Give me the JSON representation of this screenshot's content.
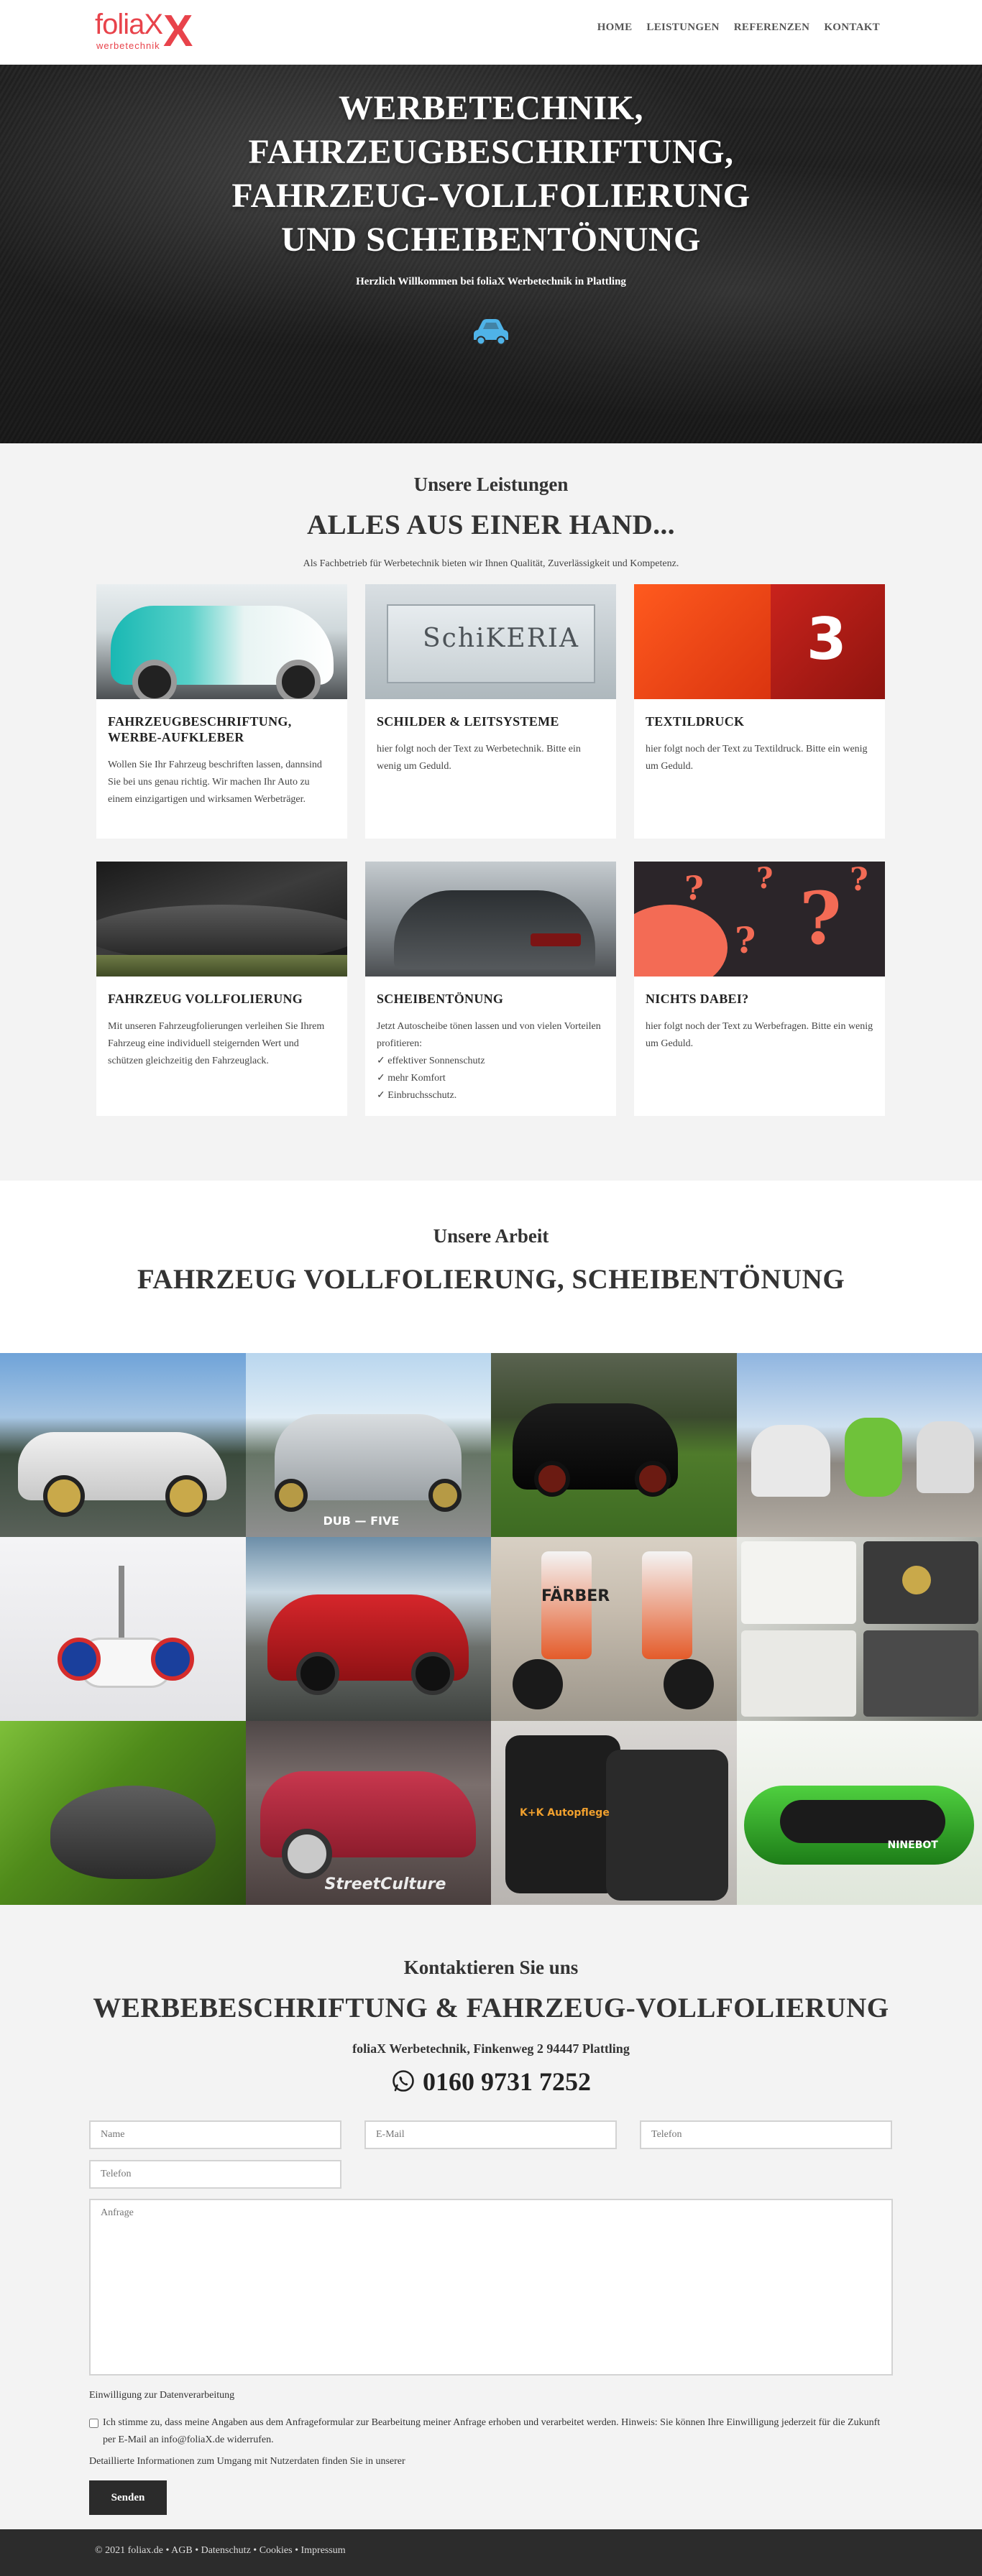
{
  "brand": {
    "logo_word": "foliaX",
    "logo_sub": "werbetechnik",
    "logo_x": "X",
    "accent": "#e8434b"
  },
  "nav": {
    "items": [
      {
        "label": "HOME"
      },
      {
        "label": "LEISTUNGEN"
      },
      {
        "label": "REFERENZEN"
      },
      {
        "label": "KONTAKT"
      }
    ]
  },
  "hero": {
    "title_lines": [
      "WERBETECHNIK,",
      "FAHRZEUGBESCHRIFTUNG,",
      "FAHRZEUG-VOLLFOLIERUNG",
      "UND SCHEIBENTÖNUNG"
    ],
    "subtitle": "Herzlich Willkommen bei foliaX Werbetechnik in Plattling",
    "icon": "car-icon",
    "icon_color": "#4fb3e8"
  },
  "services": {
    "kicker": "Unsere Leistungen",
    "title": "ALLES AUS EINER HAND...",
    "intro": "Als Fachbetrieb für Werbetechnik bieten wir Ihnen Qualität, Zuverlässigkeit und Kompetenz.",
    "cards": [
      {
        "title": "FAHRZEUGBESCHRIFTUNG, WERBE-AUFKLEBER",
        "text": "Wollen Sie Ihr Fahrzeug beschriften lassen, dannsind Sie bei uns genau richtig. Wir machen Ihr Auto zu einem einzigartigen und wirksamen Werbeträger."
      },
      {
        "title": "SCHILDER & LEITSYSTEME",
        "text": "hier folgt noch der Text zu Werbetechnik. Bitte ein wenig um Geduld.",
        "image_text": "SchiKERIA"
      },
      {
        "title": "TEXTILDRUCK",
        "text": "hier folgt noch der Text zu Textildruck. Bitte ein wenig um Geduld.",
        "image_text": "3"
      },
      {
        "title": "FAHRZEUG VOLLFOLIERUNG",
        "text": "Mit unseren Fahrzeugfolierungen verleihen Sie Ihrem Fahrzeug eine individuell steigernden Wert und schützen gleichzeitig den Fahrzeuglack."
      },
      {
        "title": "SCHEIBENTÖNUNG",
        "text": "Jetzt Autoscheibe tönen lassen und von vielen Vorteilen profitieren:",
        "list": [
          "✓ effektiver Sonnenschutz",
          "✓ mehr Komfort",
          "✓ Einbruchsschutz."
        ]
      },
      {
        "title": "NICHTS DABEI?",
        "text": "hier folgt noch der Text zu Werbefragen. Bitte ein wenig um Geduld.",
        "image_text": "?"
      }
    ]
  },
  "work": {
    "kicker": "Unsere Arbeit",
    "title": "FAHRZEUG VOLLFOLIERUNG, SCHEIBENTÖNUNG",
    "gallery_texts": {
      "dub_five": "DUB — FIVE",
      "faerber": "FÄRBER",
      "streetculture": "StreetCulture",
      "ka_autopflege": "K+K Autopflege",
      "ninebot": "NINEBOT"
    }
  },
  "contact": {
    "kicker": "Kontaktieren Sie uns",
    "title": "WERBEBESCHRIFTUNG & FAHRZEUG-VOLLFOLIERUNG",
    "address": "foliaX Werbetechnik, Finkenweg 2 94447 Plattling",
    "phone": "0160 9731 7252",
    "phone_icon": "whatsapp-icon",
    "form": {
      "name_placeholder": "Name",
      "email_placeholder": "E-Mail",
      "tel_placeholder": "Telefon",
      "tel2_placeholder": "Telefon",
      "message_placeholder": "Anfrage",
      "consent_heading": "Einwilligung zur Datenverarbeitung",
      "consent_text": "Ich stimme zu, dass meine Angaben aus dem Anfrageformular zur Bearbeitung meiner Anfrage erhoben und verarbeitet werden. Hinweis: Sie können Ihre Einwilligung jederzeit für die Zukunft per E-Mail an info@foliaX.de widerrufen.",
      "detail_text": "Detaillierte Informationen zum Umgang mit Nutzerdaten finden Sie in unserer",
      "submit_label": "Senden"
    }
  },
  "footer": {
    "text": "© 2021 foliax.de • AGB • Datenschutz • Cookies • Impressum"
  }
}
